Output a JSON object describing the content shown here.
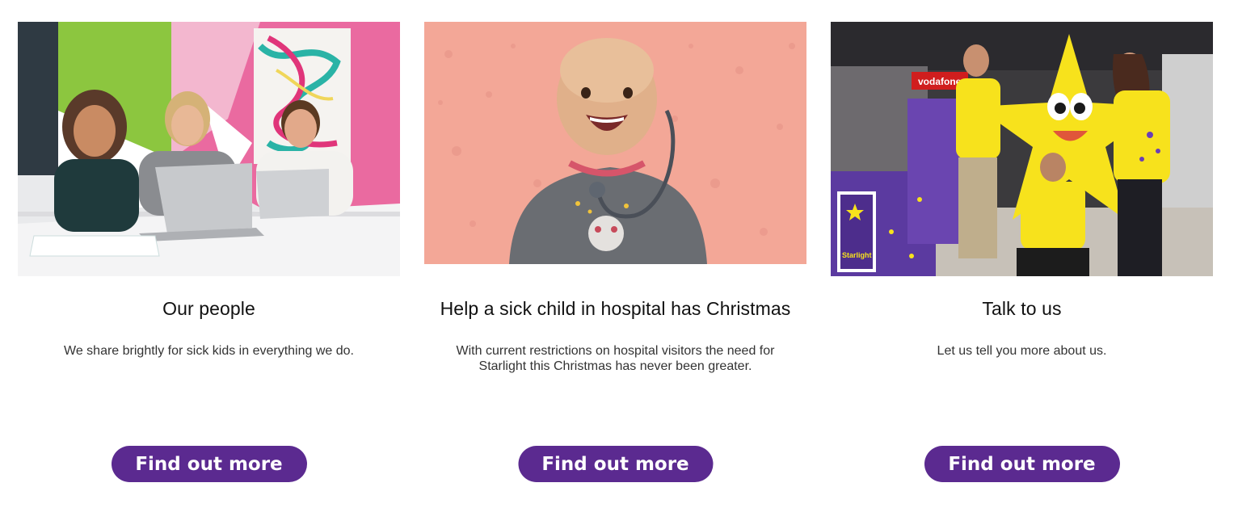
{
  "cards": [
    {
      "title": "Our people",
      "description": "We share brightly for sick kids in everything we do.",
      "button_label": "Find out more"
    },
    {
      "title": "Help a sick child in hospital has Christmas",
      "description": "With current restrictions on hospital visitors the need for Starlight this Christmas has never been greater.",
      "button_label": "Find out more"
    },
    {
      "title": "Talk to us",
      "description": "Let us tell you more about us.",
      "button_label": "Find out more"
    }
  ],
  "colors": {
    "button_bg": "#5b2a90",
    "button_text": "#ffffff",
    "card2_bg_pink": "#f3a797",
    "brand_yellow": "#f7e21c",
    "brand_purple": "#5b2a90"
  },
  "image_text": {
    "vodafone_sign": "vodafone",
    "starlight_logo": "Starlight"
  }
}
